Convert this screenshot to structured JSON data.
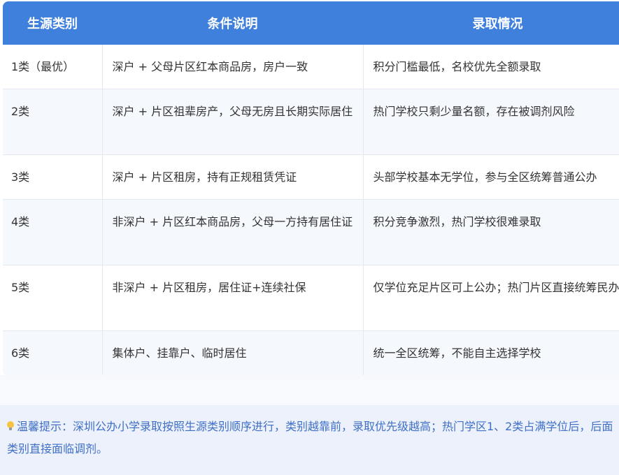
{
  "table": {
    "headers": [
      "生源类别",
      "条件说明",
      "录取情况"
    ],
    "rows": [
      [
        "1类（最优）",
        "深户 + 父母片区红本商品房，房户一致",
        "积分门槛最低，名校优先全额录取"
      ],
      [
        "2类",
        "深户 + 片区祖辈房产，父母无房且长期实际居住",
        "热门学校只剩少量名额，存在被调剂风险"
      ],
      [
        "3类",
        "深户 + 片区租房，持有正规租赁凭证",
        "头部学校基本无学位，参与全区统筹普通公办"
      ],
      [
        "4类",
        "非深户 + 片区红本商品房，父母一方持有居住证",
        "积分竞争激烈，热门学校很难录取"
      ],
      [
        "5类",
        "非深户 + 片区租房，居住证+连续社保",
        "仅学位充足片区可上公办；热门片区直接统筹民办"
      ],
      [
        "6类",
        "集体户、挂靠户、临时居住",
        "统一全区统筹，不能自主选择学校"
      ]
    ]
  },
  "tip": {
    "icon": "lightbulb-icon",
    "text": "温馨提示：深圳公办小学录取按照生源类别顺序进行，类别越靠前，录取优先级越高；热门学区1、2类占满学位后，后面类别直接面临调剂。"
  },
  "colors": {
    "header_bg": "#3f80dd",
    "tip_text": "#3f6fc7",
    "tip_bg": "#ecf1fb"
  }
}
